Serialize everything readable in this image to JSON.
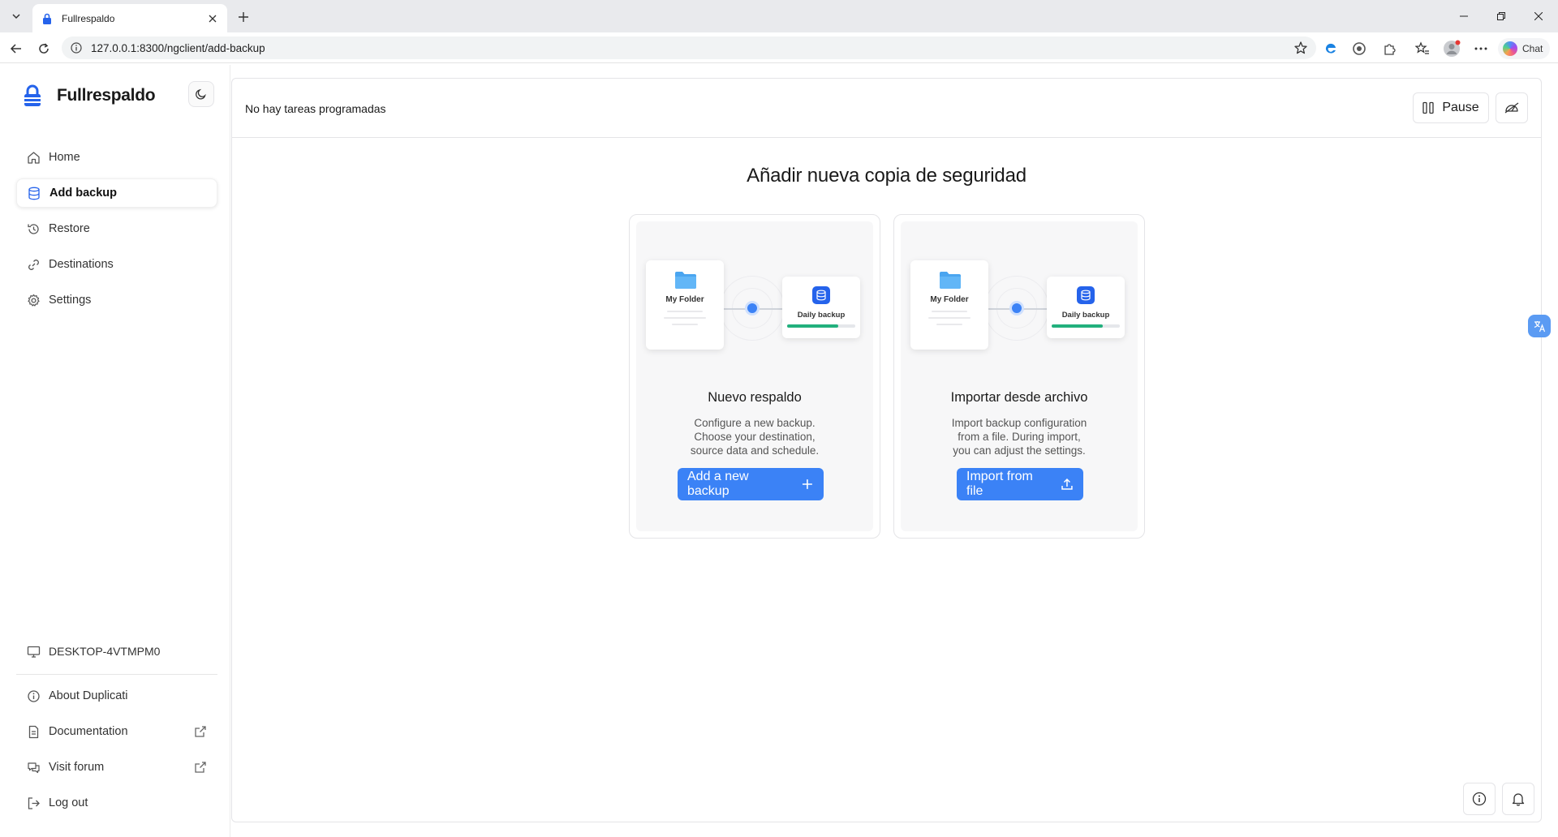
{
  "browser": {
    "tab_title": "Fullrespaldo",
    "url": "127.0.0.1:8300/ngclient/add-backup",
    "chat_label": "Chat"
  },
  "sidebar": {
    "brand": "Fullrespaldo",
    "nav": [
      {
        "label": "Home",
        "icon": "home-icon"
      },
      {
        "label": "Add backup",
        "icon": "database-icon",
        "active": true
      },
      {
        "label": "Restore",
        "icon": "history-icon"
      },
      {
        "label": "Destinations",
        "icon": "link-icon"
      },
      {
        "label": "Settings",
        "icon": "gear-icon"
      }
    ],
    "device": "DESKTOP-4VTMPM0",
    "bottom": [
      {
        "label": "About Duplicati",
        "icon": "info-icon"
      },
      {
        "label": "Documentation",
        "icon": "document-icon",
        "external": true
      },
      {
        "label": "Visit forum",
        "icon": "chat-bubbles-icon",
        "external": true
      },
      {
        "label": "Log out",
        "icon": "logout-icon"
      }
    ]
  },
  "header": {
    "schedule_status": "No hay tareas programadas",
    "pause_label": "Pause"
  },
  "main": {
    "title": "Añadir nueva copia de seguridad",
    "cards": [
      {
        "title": "Nuevo respaldo",
        "desc": [
          "Configure a new backup.",
          "Choose your destination,",
          "source data and schedule."
        ],
        "button": "Add a new backup",
        "folder_label": "My Folder",
        "dest_label": "Daily backup"
      },
      {
        "title": "Importar desde archivo",
        "desc": [
          "Import backup configuration",
          "from a file. During import,",
          "you can adjust the settings."
        ],
        "button": "Import from file",
        "folder_label": "My Folder",
        "dest_label": "Daily backup"
      }
    ]
  },
  "colors": {
    "accent": "#3b82f6",
    "progress": "#22b07d",
    "border": "#e4e4e7"
  }
}
